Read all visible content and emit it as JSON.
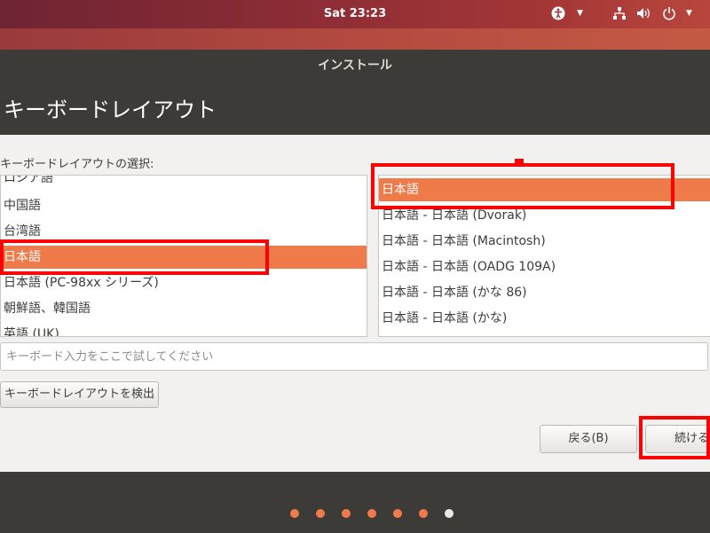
{
  "topbar": {
    "clock": "Sat 23:23"
  },
  "window": {
    "title": "インストール",
    "heading": "キーボードレイアウト"
  },
  "layout": {
    "prompt": "キーボードレイアウトの選択:",
    "languages": [
      "ロシア語",
      "中国語",
      "台湾語",
      "日本語",
      "日本語 (PC-98xx シリーズ)",
      "朝鮮語、韓国語",
      "英語 (UK)"
    ],
    "selected_language": "日本語",
    "variants": [
      "日本語",
      "日本語 - 日本語 (Dvorak)",
      "日本語 - 日本語 (Macintosh)",
      "日本語 - 日本語 (OADG 109A)",
      "日本語 - 日本語 (かな 86)",
      "日本語 - 日本語 (かな)"
    ],
    "selected_variant": "日本語",
    "test_placeholder": "キーボード入力をここで試してください",
    "detect_label": "キーボードレイアウトを検出"
  },
  "nav": {
    "back_label": "戻る(B)",
    "continue_label": "続ける"
  },
  "progress": {
    "total_steps": 7,
    "current_step": 7
  },
  "colors": {
    "accent": "#ef7b4b",
    "highlight_box": "#ff0000",
    "topbar": "#8e2d35"
  }
}
